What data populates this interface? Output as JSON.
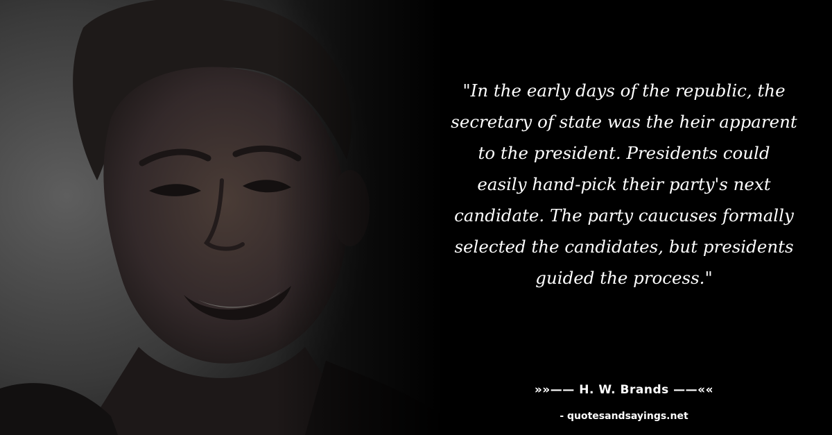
{
  "photo": {
    "subject": "portrait-photo",
    "tone": "#3a3a3a"
  },
  "quote": {
    "lines": [
      "\"In the early days of the republic, the",
      "secretary of state was the heir apparent",
      "to the president. Presidents could",
      "easily hand-pick their party's next",
      "candidate. The party caucuses formally",
      "selected the candidates, but presidents",
      "guided the process.\""
    ]
  },
  "author": {
    "text": "»»—— H. W. Brands ——««"
  },
  "source": {
    "text": "- quotesandsayings.net"
  },
  "colors": {
    "background": "#000000",
    "text": "#ffffff"
  }
}
